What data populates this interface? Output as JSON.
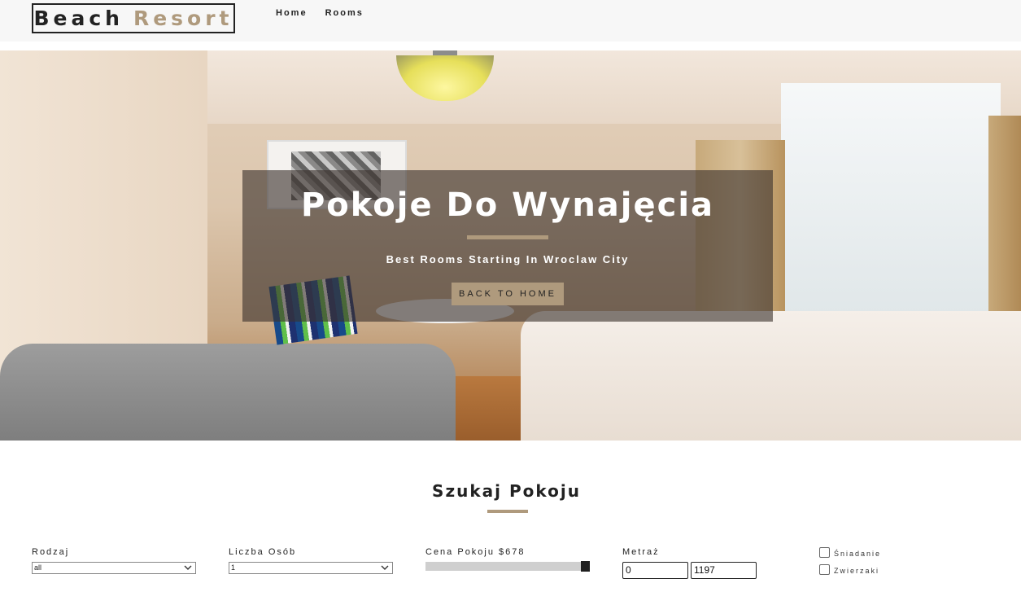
{
  "navbar": {
    "logo_part1": "Beach",
    "logo_part2": "Resort",
    "links": [
      "Home",
      "Rooms"
    ]
  },
  "hero": {
    "title": "Pokoje Do Wynajęcia",
    "subtitle": "Best Rooms Starting In Wroclaw City",
    "button_label": "BACK TO HOME"
  },
  "search": {
    "title": "Szukaj Pokoju",
    "type": {
      "label": "Rodzaj",
      "selected": "all"
    },
    "guests": {
      "label": "Liczba Osób",
      "selected": "1"
    },
    "price": {
      "label": "Cena Pokoju $678",
      "value": 678,
      "max": 678
    },
    "size": {
      "label": "Metraż",
      "min_value": "0",
      "max_value": "1197"
    },
    "breakfast": {
      "label": "Śniadanie",
      "checked": false
    },
    "pets": {
      "label": "Zwierzaki",
      "checked": false
    }
  },
  "colors": {
    "accent": "#af9a7d",
    "navbar_bg": "#f7f7f7",
    "text": "#222222"
  }
}
